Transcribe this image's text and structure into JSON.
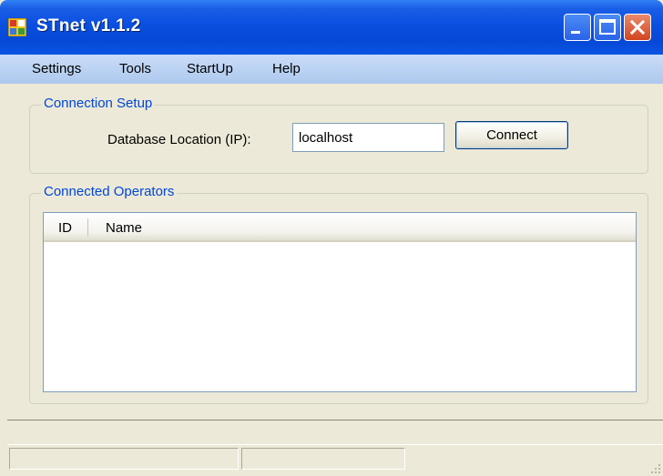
{
  "window": {
    "title": "STnet v1.1.2"
  },
  "menu": {
    "items": [
      "Settings",
      "Tools",
      "StartUp",
      "Help"
    ]
  },
  "connection_setup": {
    "title": "Connection Setup",
    "db_label": "Database Location (IP):",
    "db_value": "localhost",
    "connect_label": "Connect"
  },
  "operators": {
    "title": "Connected Operators",
    "columns": [
      "ID",
      "Name"
    ]
  },
  "colors": {
    "group_title": "#0046d5",
    "titlebar": "#0a4fe0",
    "close_button": "#d2451e"
  }
}
